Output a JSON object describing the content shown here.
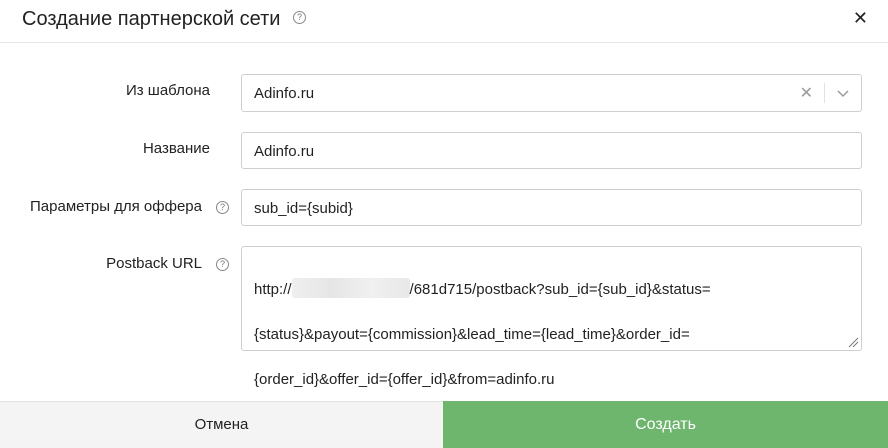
{
  "dialog": {
    "title": "Создание партнерской сети",
    "help_glyph": "?",
    "close_glyph": "✕"
  },
  "form": {
    "template": {
      "label": "Из шаблона",
      "value": "Adinfo.ru",
      "clear_glyph": "✕"
    },
    "name": {
      "label": "Название",
      "value": "Adinfo.ru"
    },
    "offer_params": {
      "label": "Параметры для оффера",
      "value": "sub_id={subid}"
    },
    "postback_url": {
      "label": "Postback URL",
      "value_prefix": "http://",
      "value_line1_rest": "/681d715/postback?sub_id={sub_id}&status=",
      "value_line2": "{status}&payout={commission}&lead_time={lead_time}&order_id=",
      "value_line3": "{order_id}&offer_id={offer_id}&from=adinfo.ru"
    }
  },
  "footer": {
    "cancel_label": "Отмена",
    "create_label": "Создать"
  },
  "colors": {
    "primary_button": "#6eb56e",
    "cancel_button": "#f4f4f4"
  }
}
